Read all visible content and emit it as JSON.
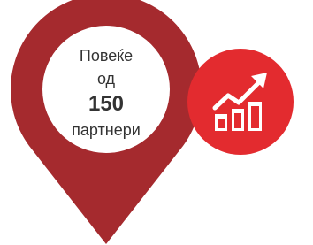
{
  "pin": {
    "line1": "Повеќе",
    "line2": "од",
    "number": "150",
    "line3": "партнери",
    "color": "#a52a2e",
    "inner_color": "#ffffff"
  },
  "badge": {
    "icon": "growth-chart-icon",
    "color": "#e32b2f",
    "icon_color": "#ffffff"
  }
}
